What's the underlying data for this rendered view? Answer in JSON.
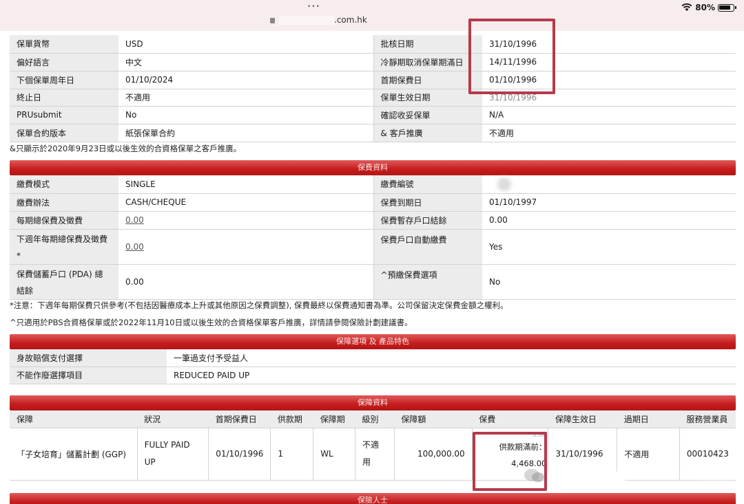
{
  "status": {
    "battery": "80%"
  },
  "browser": {
    "url_suffix": ".com.hk",
    "dots": "•••"
  },
  "policy_rows": [
    {
      "l1": "保單貨幣",
      "v1": "USD",
      "l2": "批核日期",
      "v2": "31/10/1996"
    },
    {
      "l1": "偏好語言",
      "v1": "中文",
      "l2": "冷靜期取消保單期滿日",
      "v2": "14/11/1996"
    },
    {
      "l1": "下個保單周年日",
      "v1": "01/10/2024",
      "l2": "首期保費日",
      "v2": "01/10/1996"
    },
    {
      "l1": "終止日",
      "v1": "不適用",
      "l2": "保單生效日期",
      "v2": "31/10/1996"
    },
    {
      "l1": "PRUsubmit",
      "v1": "No",
      "l2": "確認收妥保單",
      "v2": "N/A"
    },
    {
      "l1": "保單合約版本",
      "v1": "紙張保單合約",
      "l2": "& 客戶推廣",
      "v2": "不適用"
    }
  ],
  "note1": "&只顯示於2020年9月23日或以後生效的合資格保單之客戶推廣。",
  "premium": {
    "title": "保費資料",
    "rows": [
      {
        "l1": "繳費模式",
        "v1": "SINGLE",
        "l2": "繳費編號",
        "v2": ""
      },
      {
        "l1": "繳費辦法",
        "v1": "CASH/CHEQUE",
        "l2": "保費到期日",
        "v2": "01/10/1997"
      },
      {
        "l1": "每期總保費及徵費",
        "v1": "0.00",
        "l2": "保費暫存戶口結餘",
        "v2": "0.00"
      },
      {
        "l1": "下週年每期總保費及徵費",
        "l1b": "*",
        "v1": "0.00",
        "l2": "保費戶口自動繳費",
        "v2": "Yes"
      },
      {
        "l1": "保費儲蓄戶口 (PDA) 總",
        "l1b": "結餘",
        "v1": "0.00",
        "l2": "^預繳保費選項",
        "v2": "No"
      }
    ],
    "note_a": "*注意：下週年每期保費只供參考(不包括因醫療成本上升或其他原因之保費調整), 保費最終以保費通知書為準。公司保留決定保費金額之權利。",
    "note_b": "^只適用於PBS合資格保單或於2022年11月10日或以後生效的合資格保單客戶推廣，詳情請參閱保險計劃建議書。"
  },
  "options": {
    "title": "保障選項 及 產品特色",
    "rows": [
      {
        "l": "身故賠償支付選擇",
        "v": "一筆過支付予受益人"
      },
      {
        "l": "不能作廢選擇項目",
        "v": "REDUCED PAID UP"
      }
    ]
  },
  "coverage": {
    "title": "保障資料",
    "headers": [
      "保障",
      "狀況",
      "首期保費日",
      "供款期",
      "保障期",
      "級別",
      "保障額",
      "保費",
      "保障生效日",
      "過期日",
      "服務營業員"
    ],
    "row": {
      "plan": "「子女培育」儲蓄計劃 (GGP)",
      "status_l1": "FULLY PAID",
      "status_l2": "UP",
      "first_date": "01/10/1996",
      "pay_term": "1",
      "cover_term": "WL",
      "class_l1": "不適",
      "class_l2": "用",
      "sum": "100,000.00",
      "premium_faint": "0.00",
      "premium_l1": "供款期滿前：",
      "premium_l2": "4,468.00",
      "effective": "31/10/1996",
      "expiry": "不適用",
      "agent": "00010423"
    }
  },
  "insured_title": "保險人士",
  "colors": {
    "section_red": "#c41c1c",
    "highlight": "#b53a4c",
    "label_bg": "#ececec"
  }
}
